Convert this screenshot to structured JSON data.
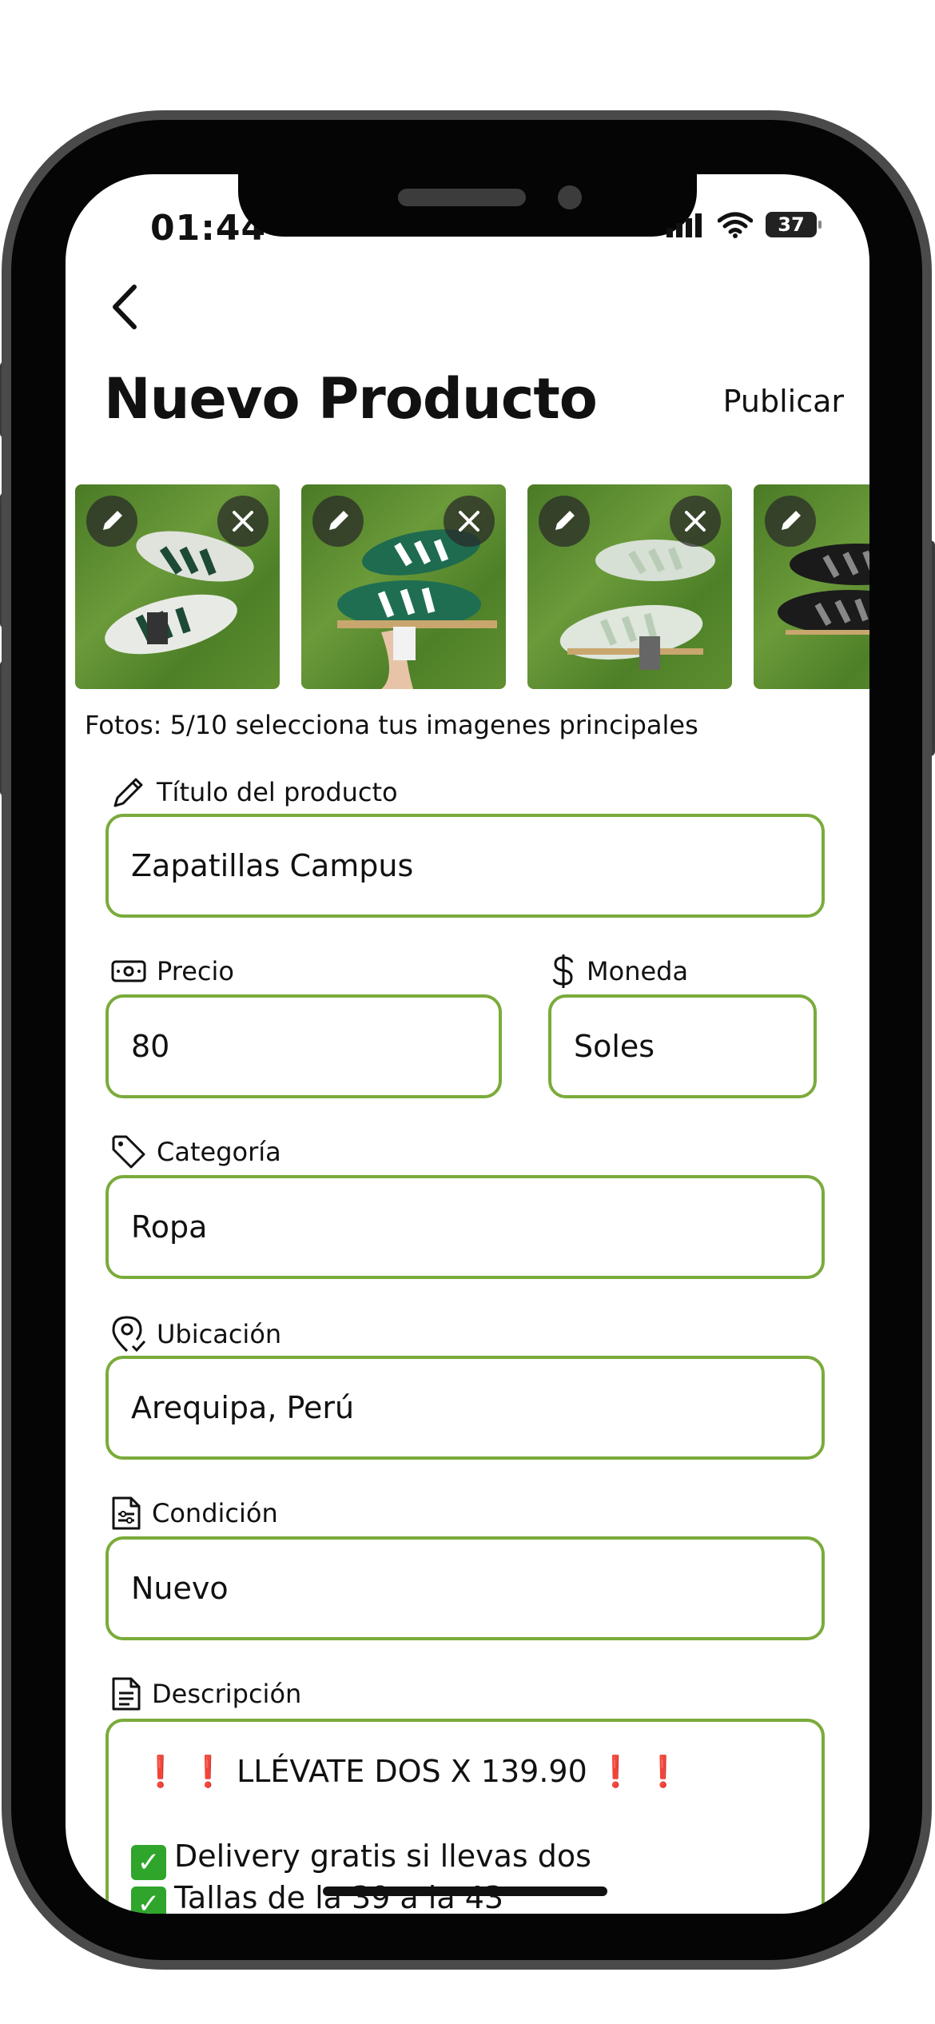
{
  "status": {
    "time": "01:44",
    "battery": "37"
  },
  "header": {
    "title": "Nuevo Producto",
    "publish_label": "Publicar"
  },
  "photos": {
    "count_text": "Fotos: 5/10 selecciona tus imagenes principales"
  },
  "form": {
    "title_label": "Título del producto",
    "title_value": "Zapatillas Campus",
    "price_label": "Precio",
    "price_value": "80",
    "currency_label": "Moneda",
    "currency_value": "Soles",
    "category_label": "Categoría",
    "category_value": "Ropa",
    "location_label": "Ubicación",
    "location_value": "Arequipa, Perú",
    "condition_label": "Condición",
    "condition_value": "Nuevo",
    "description_label": "Descripción",
    "description_line1": "LLÉVATE DOS X 139.90",
    "description_line2": "Delivery gratis si llevas dos",
    "description_line3": "Tallas de la 39 a la 43"
  },
  "colors": {
    "field_border": "#7aab3b",
    "accent_green": "#2fa52b",
    "alert_red": "#d0021b"
  }
}
